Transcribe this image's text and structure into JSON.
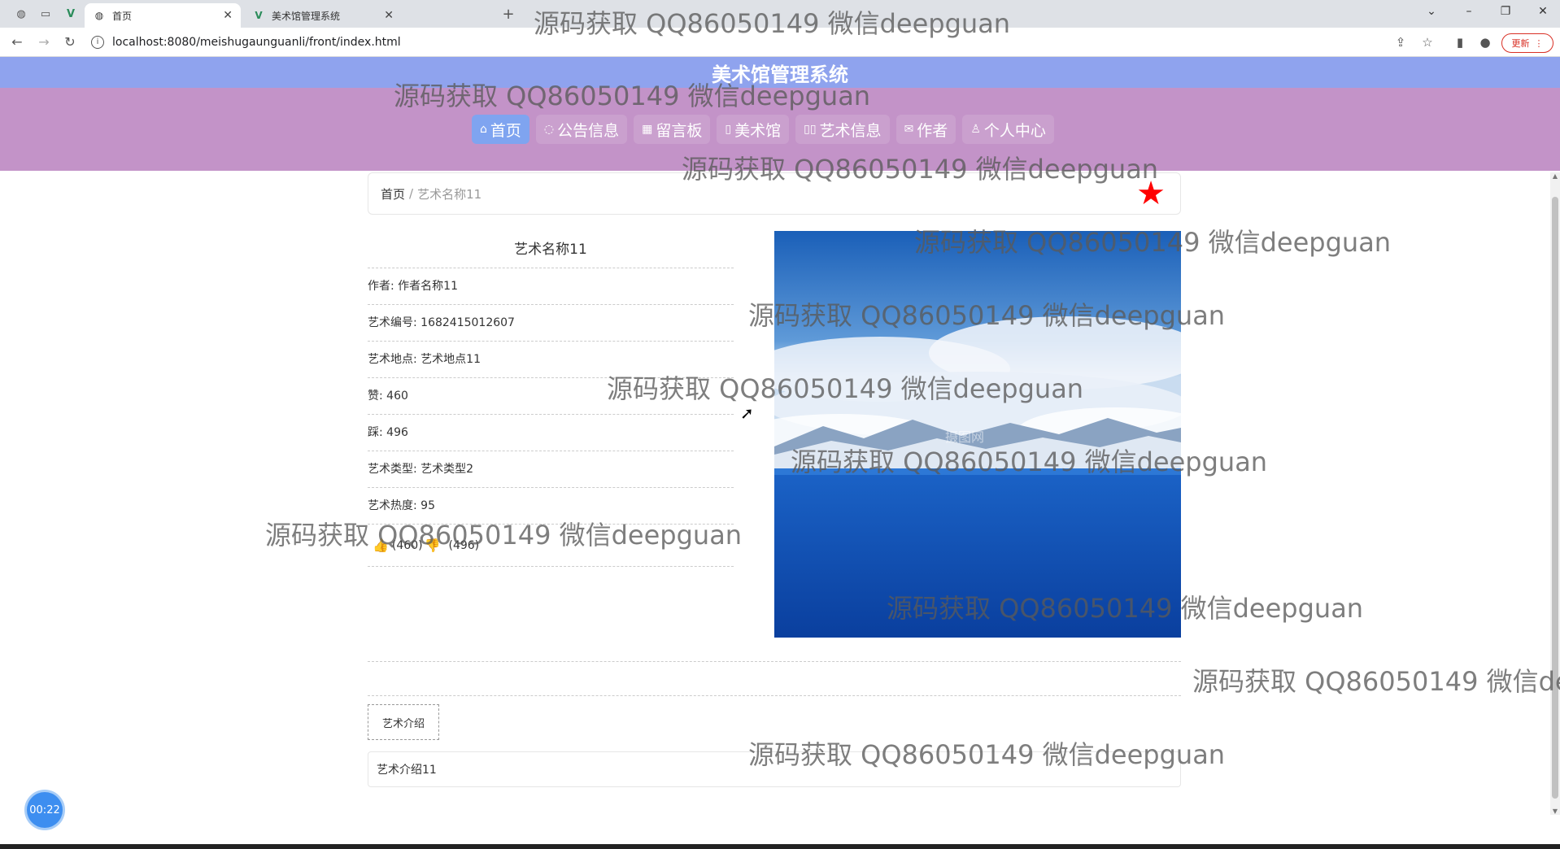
{
  "browser": {
    "tabs": [
      {
        "label": "首页",
        "active": true
      },
      {
        "label": "美术馆管理系统",
        "active": false
      }
    ],
    "url": "localhost:8080/meishugaunguanli/front/index.html",
    "update_label": "更新"
  },
  "site": {
    "title": "美术馆管理系统",
    "nav": [
      {
        "label": "首页",
        "icon": "home-icon",
        "active": true
      },
      {
        "label": "公告信息",
        "icon": "bell-icon",
        "active": false
      },
      {
        "label": "留言板",
        "icon": "board-icon",
        "active": false
      },
      {
        "label": "美术馆",
        "icon": "doc-icon",
        "active": false
      },
      {
        "label": "艺术信息",
        "icon": "book-icon",
        "active": false
      },
      {
        "label": "作者",
        "icon": "mail-icon",
        "active": false
      },
      {
        "label": "个人中心",
        "icon": "user-icon",
        "active": false
      }
    ]
  },
  "breadcrumb": {
    "home": "首页",
    "sep": "/",
    "current": "艺术名称11"
  },
  "detail": {
    "title": "艺术名称11",
    "author": "作者: 作者名称11",
    "code": "艺术编号: 1682415012607",
    "location": "艺术地点: 艺术地点11",
    "likes": "赞: 460",
    "dislikes": "踩: 496",
    "type": "艺术类型: 艺术类型2",
    "heat": "艺术热度: 95",
    "like_count": "(460)",
    "dislike_count": "(496)"
  },
  "intro": {
    "tab_label": "艺术介绍",
    "content": "艺术介绍11"
  },
  "timer": "00:22",
  "watermark": "源码获取 QQ86050149 微信deepguan",
  "image_watermark": "摄图网"
}
